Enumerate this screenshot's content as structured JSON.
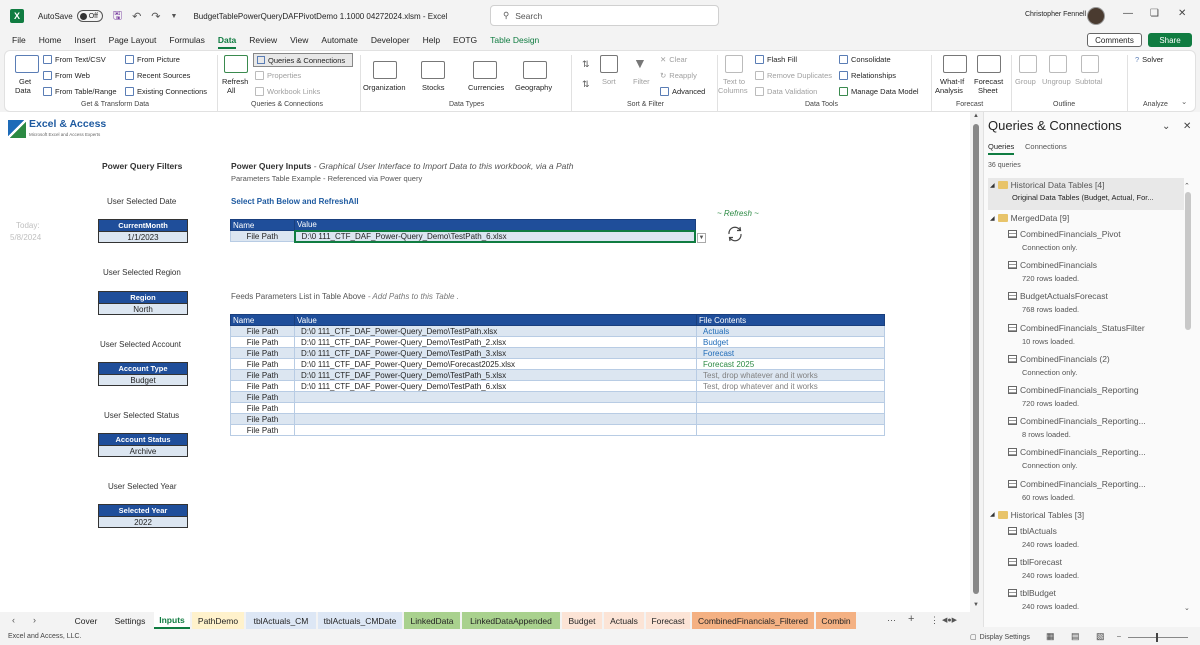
{
  "titlebar": {
    "autosave": "AutoSave",
    "toggle": "Off",
    "doc_title": "BudgetTablePowerQueryDAFPivotDemo 1.1000  04272024.xlsm  -  Excel",
    "search_placeholder": "Search",
    "user_name": "Christopher Fennell"
  },
  "menu": [
    "File",
    "Home",
    "Insert",
    "Page Layout",
    "Formulas",
    "Data",
    "Review",
    "View",
    "Automate",
    "Developer",
    "Help",
    "EOTG",
    "Table Design"
  ],
  "menu_active": "Data",
  "comments_label": "Comments",
  "share_label": "Share",
  "ribbon": {
    "get_data": "Get",
    "get_data2": "Data",
    "from_text": "From Text/CSV",
    "from_web": "From Web",
    "from_table": "From Table/Range",
    "from_picture": "From Picture",
    "recent_sources": "Recent Sources",
    "existing_connections": "Existing Connections",
    "grp_get": "Get & Transform Data",
    "refresh_all": "Refresh",
    "refresh_all2": "All",
    "queries_connections": "Queries & Connections",
    "properties": "Properties",
    "workbook_links": "Workbook Links",
    "grp_qc": "Queries & Connections",
    "organization": "Organization",
    "stocks": "Stocks",
    "currencies": "Currencies",
    "geography": "Geography",
    "grp_types": "Data Types",
    "sort": "Sort",
    "filter": "Filter",
    "clear": "Clear",
    "reapply": "Reapply",
    "advanced": "Advanced",
    "grp_sort": "Sort & Filter",
    "text_to_columns": "Text to",
    "text_to_columns2": "Columns",
    "flash_fill": "Flash Fill",
    "remove_duplicates": "Remove Duplicates",
    "data_validation": "Data Validation",
    "consolidate": "Consolidate",
    "relationships": "Relationships",
    "manage_data_model": "Manage Data Model",
    "grp_tools": "Data Tools",
    "what_if": "What-If",
    "what_if2": "Analysis",
    "forecast_sheet": "Forecast",
    "forecast_sheet2": "Sheet",
    "grp_forecast": "Forecast",
    "group": "Group",
    "ungroup": "Ungroup",
    "subtotal": "Subtotal",
    "grp_outline": "Outline",
    "solver": "Solver",
    "grp_analyze": "Analyze"
  },
  "sheet": {
    "logo_title": "Excel & Access",
    "logo_sub": "Microsoft Excel and Access Experts",
    "pq_filters": "Power Query Filters",
    "pq_inputs": "Power Query Inputs",
    "pq_inputs_desc": " - Graphical User Interface to Import Data to this workbook, via a Path",
    "params_example": "Parameters Table Example - Referenced via Power query",
    "select_path": "Select Path Below and RefreshAll",
    "refresh_note": "~ Refresh ~",
    "today_label": "Today:",
    "today_value": "5/8/2024",
    "user_sel_date": "User Selected Date",
    "user_sel_region": "User Selected Region",
    "user_sel_account": "User Selected Account",
    "user_sel_status": "User Selected Status",
    "user_sel_year": "User Selected Year",
    "feeds_label": "Feeds Parameters List in Table Above",
    "feeds_desc": " - Add Paths to this Table .",
    "params": [
      {
        "header": "CurrentMonth",
        "value": "1/1/2023"
      },
      {
        "header": "Region",
        "value": "North"
      },
      {
        "header": "Account Type",
        "value": "Budget"
      },
      {
        "header": "Account Status",
        "value": "Archive"
      },
      {
        "header": "Selected Year",
        "value": "2022"
      }
    ],
    "path_table": {
      "headers": [
        "Name",
        "Value"
      ],
      "rows": [
        [
          "File Path",
          "D:\\0   111_CTF_DAF_Power-Query_Demo\\TestPath_6.xlsx"
        ]
      ]
    },
    "list_table": {
      "headers": [
        "Name",
        "Value",
        "File Contents"
      ],
      "rows": [
        [
          "File Path",
          "D:\\0   111_CTF_DAF_Power-Query_Demo\\TestPath.xlsx",
          "Actuals"
        ],
        [
          "File Path",
          "D:\\0   111_CTF_DAF_Power-Query_Demo\\TestPath_2.xlsx",
          "Budget"
        ],
        [
          "File Path",
          "D:\\0   111_CTF_DAF_Power-Query_Demo\\TestPath_3.xlsx",
          "Forecast"
        ],
        [
          "File Path",
          "D:\\0   111_CTF_DAF_Power-Query_Demo\\Forecast2025.xlsx",
          "Forecast 2025"
        ],
        [
          "File Path",
          "D:\\0   111_CTF_DAF_Power-Query_Demo\\TestPath_5.xlsx",
          "Test, drop whatever and it works"
        ],
        [
          "File Path",
          "D:\\0   111_CTF_DAF_Power-Query_Demo\\TestPath_6.xlsx",
          "Test, drop whatever and it works"
        ],
        [
          "File Path",
          "",
          ""
        ],
        [
          "File Path",
          "",
          ""
        ],
        [
          "File Path",
          "",
          ""
        ],
        [
          "File Path",
          "",
          ""
        ]
      ]
    }
  },
  "pane": {
    "title": "Queries & Connections",
    "tab_queries": "Queries",
    "tab_connections": "Connections",
    "count": "36 queries",
    "items": [
      {
        "kind": "folder",
        "label": "Historical Data Tables [4]"
      },
      {
        "kind": "desc",
        "label": "Original Data Tables (Budget, Actual, For..."
      },
      {
        "kind": "folder",
        "label": "MergedData [9]"
      },
      {
        "kind": "query",
        "label": "CombinedFinancials_Pivot",
        "status": "Connection only."
      },
      {
        "kind": "query",
        "label": "CombinedFinancials",
        "status": "720 rows loaded."
      },
      {
        "kind": "query",
        "label": "BudgetActualsForecast",
        "status": "768 rows loaded."
      },
      {
        "kind": "query",
        "label": "CombinedFinancials_StatusFilter",
        "status": "10 rows loaded."
      },
      {
        "kind": "query",
        "label": "CombinedFinancials (2)",
        "status": "Connection only."
      },
      {
        "kind": "query",
        "label": "CombinedFinancials_Reporting",
        "status": "720 rows loaded."
      },
      {
        "kind": "query",
        "label": "CombinedFinancials_Reporting...",
        "status": "8 rows loaded."
      },
      {
        "kind": "query",
        "label": "CombinedFinancials_Reporting...",
        "status": "Connection only."
      },
      {
        "kind": "query",
        "label": "CombinedFinancials_Reporting...",
        "status": "60 rows loaded."
      },
      {
        "kind": "folder",
        "label": "Historical Tables [3]"
      },
      {
        "kind": "query",
        "label": "tblActuals",
        "status": "240 rows loaded."
      },
      {
        "kind": "query",
        "label": "tblForecast",
        "status": "240 rows loaded."
      },
      {
        "kind": "query",
        "label": "tblBudget",
        "status": "240 rows loaded."
      }
    ]
  },
  "tabs": [
    {
      "label": "Cover",
      "color": ""
    },
    {
      "label": "Settings",
      "color": ""
    },
    {
      "label": "Inputs",
      "color": "active"
    },
    {
      "label": "PathDemo",
      "color": "#fff2cc"
    },
    {
      "label": "tblActuals_CM",
      "color": "#dde7f5"
    },
    {
      "label": "tblActuals_CMDate",
      "color": "#dde7f5"
    },
    {
      "label": "LinkedData",
      "color": "#a9d18e"
    },
    {
      "label": "LinkedDataAppended",
      "color": "#a9d18e"
    },
    {
      "label": "Budget",
      "color": "#fce4d6"
    },
    {
      "label": "Actuals",
      "color": "#fce4d6"
    },
    {
      "label": "Forecast",
      "color": "#fce4d6"
    },
    {
      "label": "CombinedFinancials_Filtered",
      "color": "#f4b183"
    },
    {
      "label": "Combin",
      "color": "#f4b183"
    }
  ],
  "status": {
    "left": "Excel and Access, LLC.",
    "display_settings": "Display Settings"
  }
}
